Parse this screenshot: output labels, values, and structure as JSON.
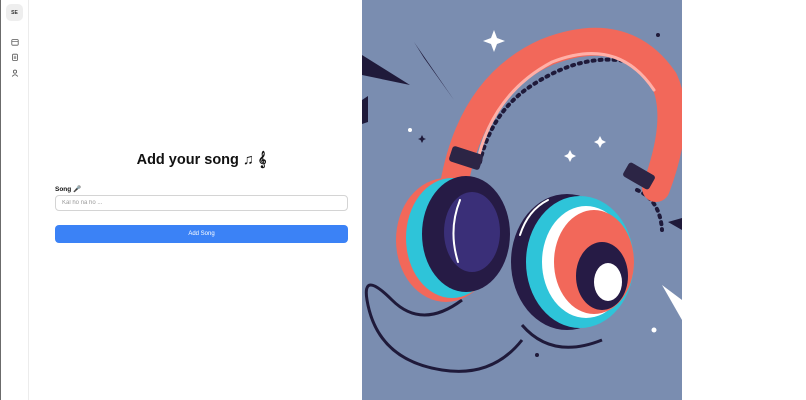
{
  "sidebar": {
    "logo_text": "SE",
    "items": [
      {
        "name": "calendar-icon"
      },
      {
        "name": "clipboard-icon"
      },
      {
        "name": "user-icon"
      }
    ]
  },
  "form": {
    "title": "Add your song ♫ 𝄞",
    "song_label": "Song 🎤",
    "song_placeholder": "Kal ho na ho ...",
    "song_value": "",
    "submit_label": "Add Song"
  },
  "illustration": {
    "subject": "headphones-illustration",
    "background_color": "#7a8db0",
    "accent_colors": [
      "#f2685a",
      "#2ec4d9",
      "#261b45",
      "#ffffff"
    ]
  }
}
